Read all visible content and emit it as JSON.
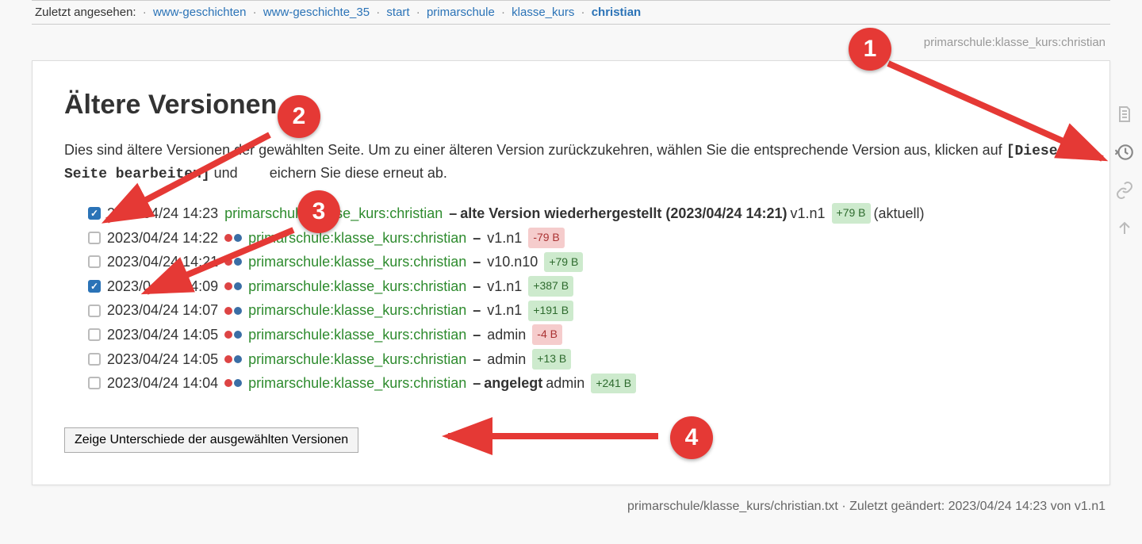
{
  "breadcrumb": {
    "label": "Zuletzt angesehen:",
    "items": [
      {
        "text": "www-geschichten",
        "href": "#"
      },
      {
        "text": "www-geschichte_35",
        "href": "#"
      },
      {
        "text": "start",
        "href": "#"
      },
      {
        "text": "primarschule",
        "href": "#"
      },
      {
        "text": "klasse_kurs",
        "href": "#"
      }
    ],
    "current": "christian"
  },
  "path_display": "primarschule:klasse_kurs:christian",
  "heading": "Ältere Versionen",
  "intro_part1": "Dies sind ältere Versionen der gewählten Seite. Um zu einer älteren Version zurückzukehren, wählen Sie die entsprechende Version aus, klicken auf ",
  "intro_code": "[Diese Seite bearbeiten]",
  "intro_part2_prefix": " und",
  "intro_part2_suffix": "eichern Sie diese erneut ab.",
  "revisions": [
    {
      "checked": true,
      "date": "2023/04/24 14:23",
      "show_icons": false,
      "page": "primarschule:klasse_kurs:christian",
      "summary": "alte Version wiederhergestellt (2023/04/24 14:21)",
      "user": "v1.n1",
      "size": "+79 B",
      "size_pos": true,
      "current": "(aktuell)"
    },
    {
      "checked": false,
      "date": "2023/04/24 14:22",
      "show_icons": true,
      "page": "primarschule:klasse_kurs:christian",
      "summary": "",
      "user": "v1.n1",
      "size": "-79 B",
      "size_pos": false
    },
    {
      "checked": false,
      "date": "2023/04/24 14:21",
      "show_icons": true,
      "page": "primarschule:klasse_kurs:christian",
      "summary": "",
      "user": "v10.n10",
      "size": "+79 B",
      "size_pos": true
    },
    {
      "checked": true,
      "date": "2023/04/24 14:09",
      "show_icons": true,
      "page": "primarschule:klasse_kurs:christian",
      "summary": "",
      "user": "v1.n1",
      "size": "+387 B",
      "size_pos": true
    },
    {
      "checked": false,
      "date": "2023/04/24 14:07",
      "show_icons": true,
      "page": "primarschule:klasse_kurs:christian",
      "summary": "",
      "user": "v1.n1",
      "size": "+191 B",
      "size_pos": true
    },
    {
      "checked": false,
      "date": "2023/04/24 14:05",
      "show_icons": true,
      "page": "primarschule:klasse_kurs:christian",
      "summary": "",
      "user": "admin",
      "size": "-4 B",
      "size_pos": false
    },
    {
      "checked": false,
      "date": "2023/04/24 14:05",
      "show_icons": true,
      "page": "primarschule:klasse_kurs:christian",
      "summary": "",
      "user": "admin",
      "size": "+13 B",
      "size_pos": true
    },
    {
      "checked": false,
      "date": "2023/04/24 14:04",
      "show_icons": true,
      "page": "primarschule:klasse_kurs:christian",
      "summary": "angelegt",
      "user": "admin",
      "size": "+241 B",
      "size_pos": true
    }
  ],
  "diff_button": "Zeige Unterschiede der ausgewählten Versionen",
  "footer": "primarschule/klasse_kurs/christian.txt · Zuletzt geändert: 2023/04/24 14:23 von v1.n1",
  "side_tools": {
    "show": "Seite anzeigen",
    "history": "Ältere Versionen",
    "backlinks": "Links hierher",
    "top": "Nach oben"
  },
  "annotations": [
    "1",
    "2",
    "3",
    "4"
  ]
}
